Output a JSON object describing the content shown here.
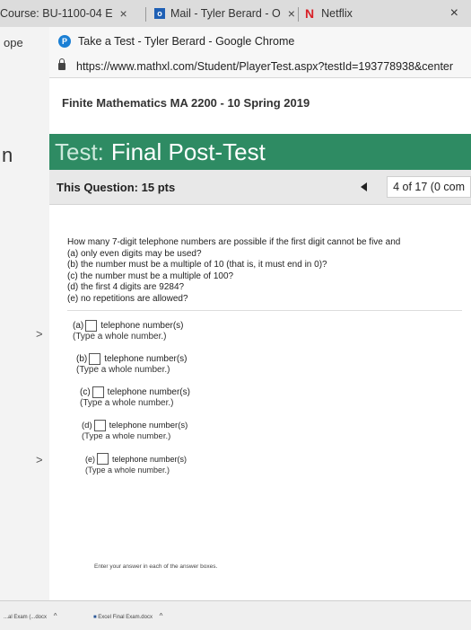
{
  "tabs": {
    "course": {
      "label": "Course: BU-1100-04 E",
      "close": "×"
    },
    "mail": {
      "label": "Mail - Tyler Berard - O",
      "close": "×",
      "icon": "outlook-icon"
    },
    "netflix": {
      "label": "Netflix",
      "icon": "netflix-icon"
    }
  },
  "window_close": "×",
  "left": {
    "tab_fragment": "ope",
    "page_fragment": "n"
  },
  "chrome": {
    "title": "Take a Test - Tyler Berard - Google Chrome",
    "url": "https://www.mathxl.com/Student/PlayerTest.aspx?testId=193778938&center"
  },
  "course_title": "Finite Mathematics MA 2200 - 10 Spring 2019",
  "test": {
    "label": "Test:",
    "name": "Final Post-Test"
  },
  "question_bar": {
    "label": "This Question:",
    "points": "15 pts",
    "count": "4 of 17 (0 com"
  },
  "question": {
    "lines": [
      "How many 7-digit telephone numbers are possible if the first digit cannot be five and",
      "(a) only even digits may be used?",
      "(b) the number must be a multiple of 10 (that is, it must end in 0)?",
      "(c) the number must be a multiple of 100?",
      "(d) the first 4 digits are 9284?",
      "(e) no repetitions are allowed?"
    ]
  },
  "answers": [
    {
      "label": "(a)",
      "suffix": "telephone number(s)",
      "hint": "(Type a whole number.)",
      "value": ""
    },
    {
      "label": "(b)",
      "suffix": "telephone number(s)",
      "hint": "(Type a whole number.)",
      "value": ""
    },
    {
      "label": "(c)",
      "suffix": "telephone number(s)",
      "hint": "(Type a whole number.)",
      "value": ""
    },
    {
      "label": "(d)",
      "suffix": "telephone number(s)",
      "hint": "(Type a whole number.)",
      "value": ""
    },
    {
      "label": "(e)",
      "suffix": "telephone number(s)",
      "hint": "(Type a whole number.)",
      "value": ""
    }
  ],
  "instruction": "Enter your answer in each of the answer boxes.",
  "downloads": [
    {
      "name": "...al Exam (...docx"
    },
    {
      "name": "Excel Final Exam.docx"
    }
  ],
  "colors": {
    "banner": "#2e8b63"
  }
}
